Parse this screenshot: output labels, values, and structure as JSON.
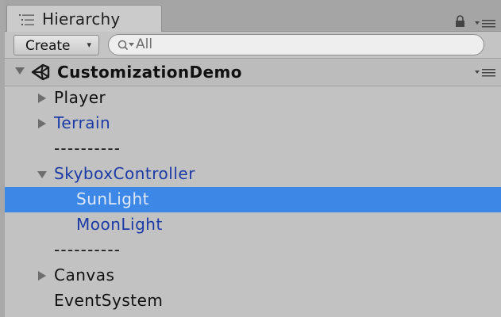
{
  "window": {
    "tab_title": "Hierarchy",
    "tab_icon": "hierarchy-list-icon"
  },
  "toolbar": {
    "create_label": "Create",
    "create_arrow": "▾",
    "search_placeholder": "All",
    "search_value": ""
  },
  "scene": {
    "name": "CustomizationDemo",
    "icon": "unity-logo-icon"
  },
  "items": [
    {
      "label": "Player",
      "depth": 0,
      "foldout": "collapsed",
      "style": "normal",
      "selected": false
    },
    {
      "label": "Terrain",
      "depth": 0,
      "foldout": "collapsed",
      "style": "prefab",
      "selected": false
    },
    {
      "label": "----------",
      "depth": 0,
      "foldout": "none",
      "style": "normal",
      "selected": false
    },
    {
      "label": "SkyboxController",
      "depth": 0,
      "foldout": "expanded",
      "style": "prefab",
      "selected": false
    },
    {
      "label": "SunLight",
      "depth": 1,
      "foldout": "none",
      "style": "prefab",
      "selected": true
    },
    {
      "label": "MoonLight",
      "depth": 1,
      "foldout": "none",
      "style": "prefab",
      "selected": false
    },
    {
      "label": "----------",
      "depth": 0,
      "foldout": "none",
      "style": "normal",
      "selected": false
    },
    {
      "label": "Canvas",
      "depth": 0,
      "foldout": "collapsed",
      "style": "normal",
      "selected": false
    },
    {
      "label": "EventSystem",
      "depth": 0,
      "foldout": "none",
      "style": "normal",
      "selected": false
    }
  ],
  "colors": {
    "panel_bg": "#c2c2c2",
    "selection": "#3d88e6",
    "prefab_text": "#1b3aa6",
    "normal_text": "#111111"
  }
}
